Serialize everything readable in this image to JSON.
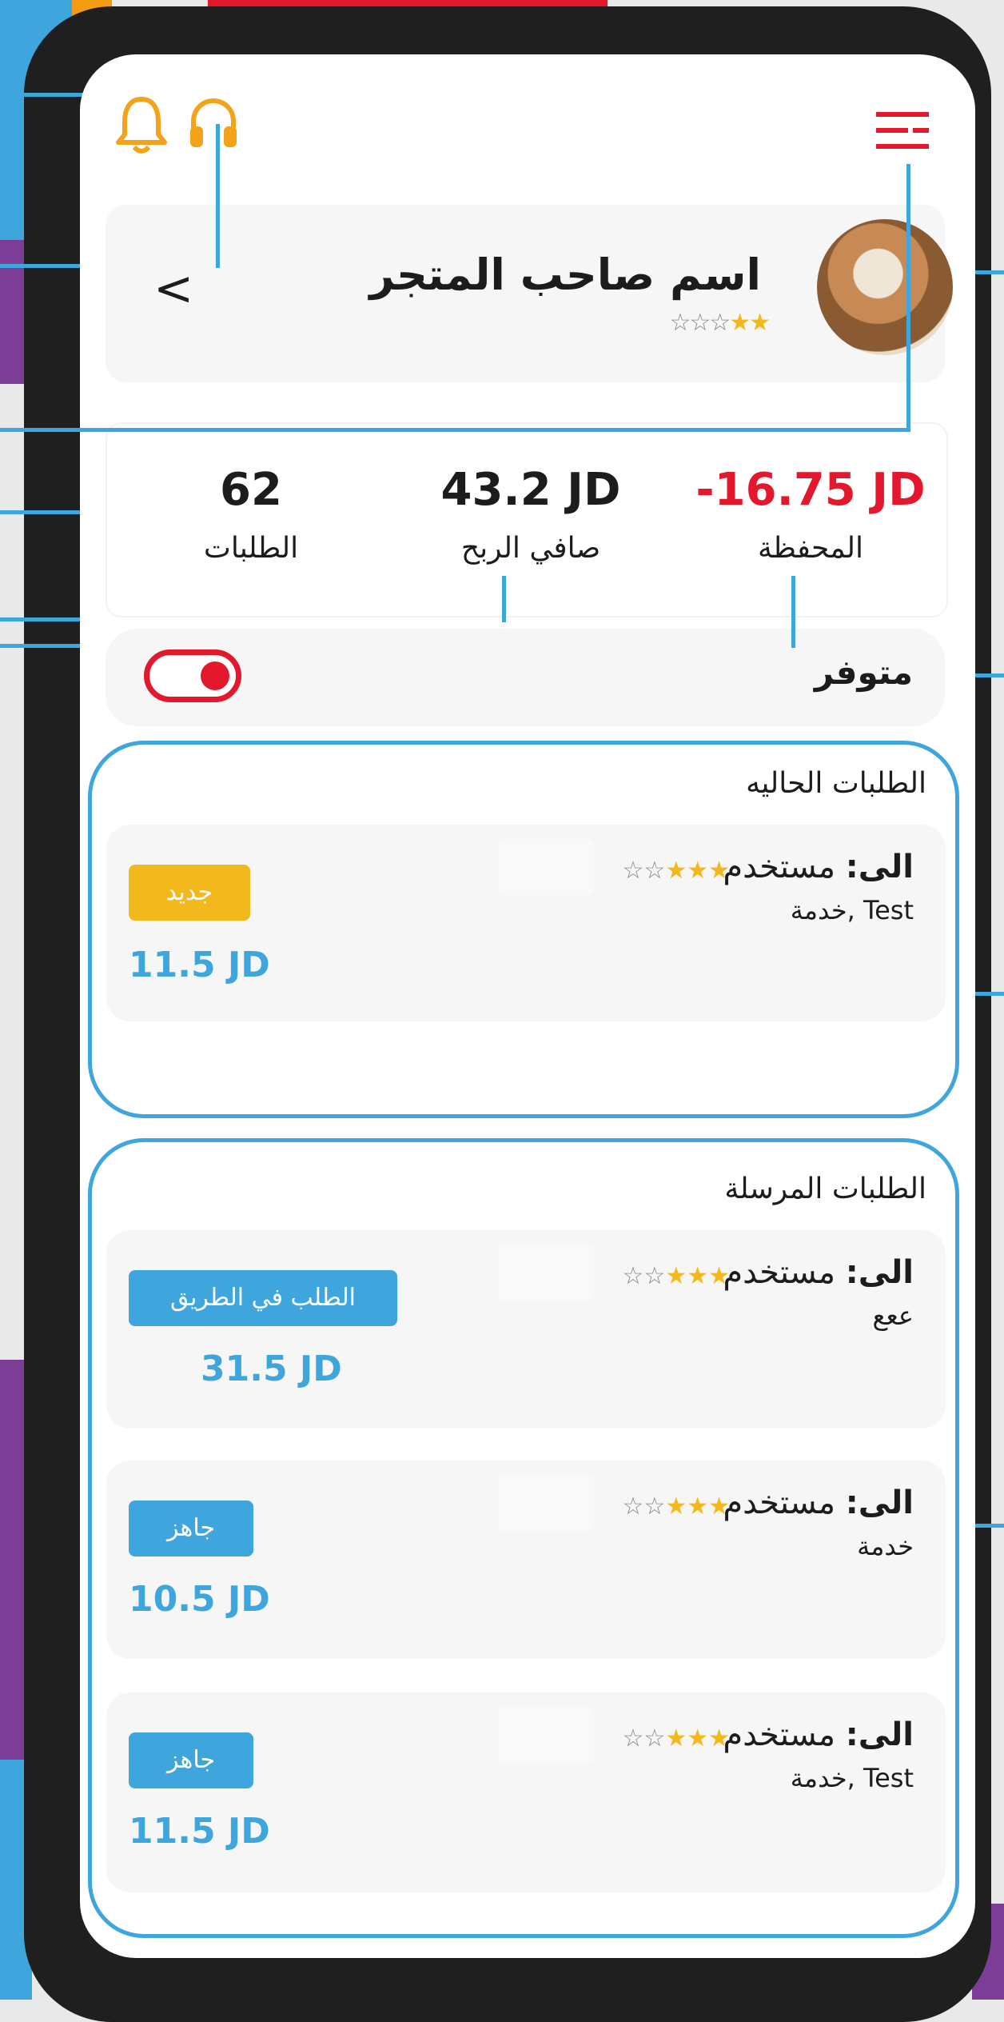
{
  "header": {
    "notification_icon": "bell-icon",
    "support_icon": "headset-icon",
    "menu_icon": "menu-icon"
  },
  "store": {
    "name": "اسم صاحب المتجر",
    "rating_stars": "★★☆☆☆",
    "rating": 2
  },
  "stats": {
    "wallet_value": "-16.75 JD",
    "wallet_label": "المحفظة",
    "profit_value": "43.2 JD",
    "profit_label": "صافي الربح",
    "orders_value": "62",
    "orders_label": "الطلبات"
  },
  "availability": {
    "label": "متوفر",
    "enabled": true
  },
  "current_orders": {
    "title": "الطلبات الحاليه",
    "items": [
      {
        "to_label": "الى:",
        "user": "مستخدم",
        "stars": "★★★☆☆",
        "service": "خدمة, Test",
        "badge": "جديد",
        "price": "11.5 JD"
      }
    ]
  },
  "sent_orders": {
    "title": "الطلبات المرسلة",
    "items": [
      {
        "to_label": "الى:",
        "user": "مستخدم",
        "stars": "★★★☆☆",
        "service": "ععع",
        "badge": "الطلب في الطريق",
        "price": "31.5 JD"
      },
      {
        "to_label": "الى:",
        "user": "مستخدم",
        "stars": "★★★☆☆",
        "service": "خدمة",
        "badge": "جاهز",
        "price": "10.5 JD"
      },
      {
        "to_label": "الى:",
        "user": "مستخدم",
        "stars": "★★★☆☆",
        "service": "خدمة, Test",
        "badge": "جاهز",
        "price": "11.5 JD"
      }
    ]
  },
  "colors": {
    "accent_blue": "#3ea6dc",
    "badge_new": "#f3b81c",
    "negative_red": "#e3182d",
    "icon_orange": "#f3a21a"
  }
}
